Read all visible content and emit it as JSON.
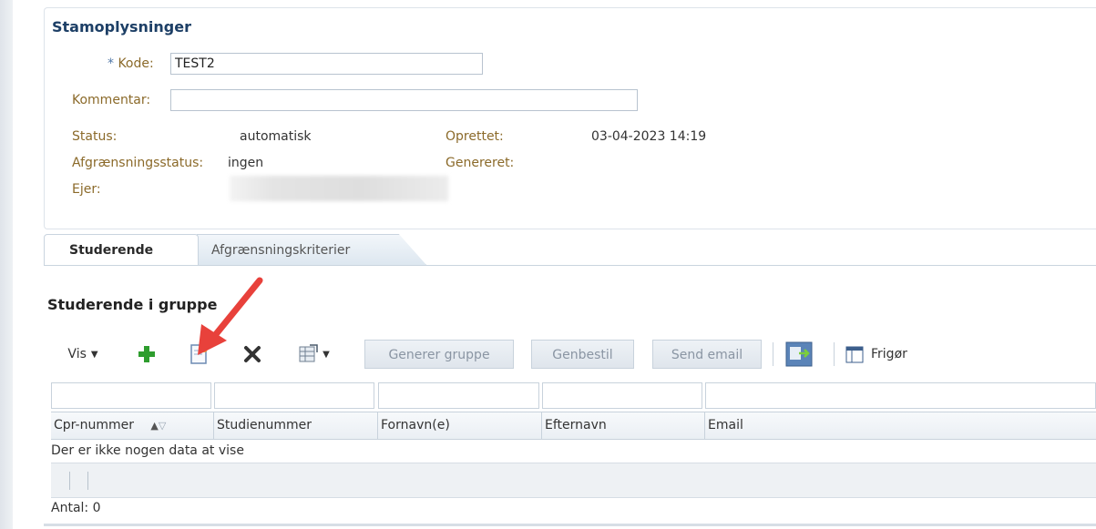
{
  "header": {
    "title": "Stamoplysninger"
  },
  "form": {
    "kode": {
      "required_marker": "*",
      "label": "Kode:",
      "value": "TEST2"
    },
    "kommentar": {
      "label": "Kommentar:",
      "value": ""
    },
    "status": {
      "label": "Status:",
      "value": "automatisk"
    },
    "afgraensningsstatus": {
      "label": "Afgrænsningsstatus:",
      "value": "ingen"
    },
    "ejer": {
      "label": "Ejer:"
    },
    "oprettet": {
      "label": "Oprettet:",
      "value": "03-04-2023 14:19"
    },
    "genereret": {
      "label": "Genereret:",
      "value": ""
    }
  },
  "tabs": [
    {
      "label": "Studerende",
      "active": true
    },
    {
      "label": "Afgrænsningskriterier",
      "active": false
    }
  ],
  "section": {
    "title": "Studerende i gruppe"
  },
  "toolbar": {
    "vis_label": "Vis",
    "generer_label": "Generer gruppe",
    "genbestil_label": "Genbestil",
    "send_email_label": "Send email",
    "frigor_label": "Frigør"
  },
  "table": {
    "columns": [
      "Cpr-nummer",
      "Studienummer",
      "Fornavn(e)",
      "Efternavn",
      "Email"
    ],
    "empty_message": "Der er ikke nogen data at vise",
    "count_label": "Antal: 0"
  },
  "colors": {
    "title": "#1d3f66",
    "label": "#8b6a2a",
    "accent_green": "#2e9d2e",
    "arrow": "#e8413b"
  }
}
